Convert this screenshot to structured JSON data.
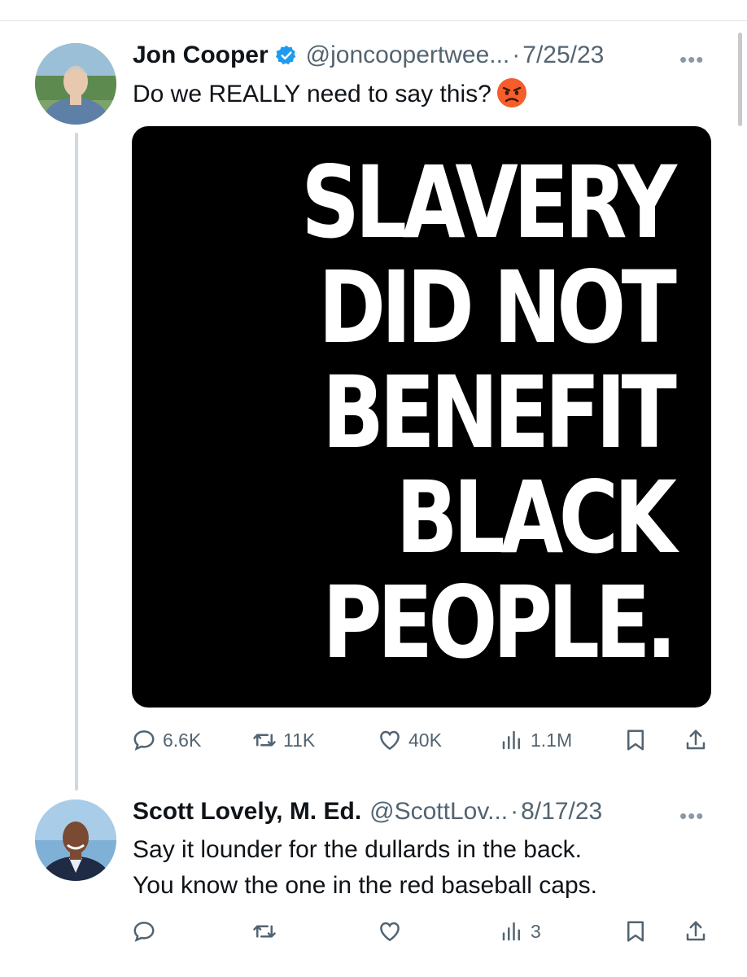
{
  "tweet1": {
    "name": "Jon Cooper",
    "handle": "@joncoopertwee...",
    "separator": "·",
    "date": "7/25/23",
    "text": "Do we REALLY need to say this?",
    "emoji": "angry-face",
    "image_lines": [
      "SLAVERY",
      "DID NOT",
      "BENEFIT",
      "BLACK",
      "PEOPLE."
    ],
    "stats": {
      "replies": "6.6K",
      "retweets": "11K",
      "likes": "40K",
      "views": "1.1M"
    }
  },
  "tweet2": {
    "name": "Scott Lovely, M. Ed.",
    "handle": "@ScottLov...",
    "separator": "·",
    "date": "8/17/23",
    "text_line1": "Say it lounder for the dullards in the back.",
    "text_line2": "You know the one in the red baseball caps.",
    "stats": {
      "replies": "",
      "retweets": "",
      "likes": "",
      "views": "3"
    }
  },
  "more_glyph": "•••",
  "colors": {
    "verified": "#1d9bf0",
    "muted": "#536471",
    "thread_line": "#cfd9de"
  }
}
